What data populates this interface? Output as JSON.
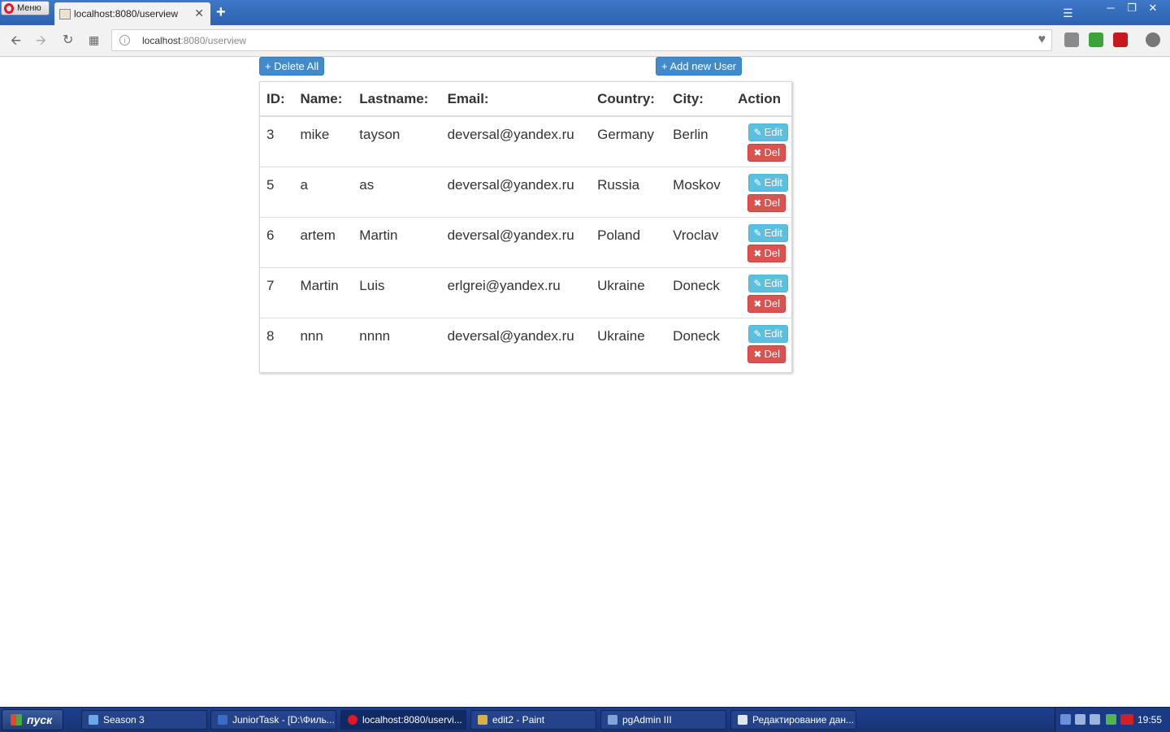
{
  "browser": {
    "menu_label": "Меню",
    "tab_title": "localhost:8080/userview",
    "tab_close": "✕",
    "new_tab": "+",
    "url_host": "localhost",
    "url_rest": ":8080/userview"
  },
  "page": {
    "delete_all_label": "+ Delete All",
    "add_user_label": "+ Add new User",
    "edit_label": "Edit",
    "del_label": "Del",
    "columns": [
      "ID:",
      "Name:",
      "Lastname:",
      "Email:",
      "Country:",
      "City:",
      "Action"
    ],
    "rows": [
      {
        "id": "3",
        "name": "mike",
        "lastname": "tayson",
        "email": "deversal@yandex.ru",
        "country": "Germany",
        "city": "Berlin"
      },
      {
        "id": "5",
        "name": "a",
        "lastname": "as",
        "email": "deversal@yandex.ru",
        "country": "Russia",
        "city": "Moskov"
      },
      {
        "id": "6",
        "name": "artem",
        "lastname": "Martin",
        "email": "deversal@yandex.ru",
        "country": "Poland",
        "city": "Vroclav"
      },
      {
        "id": "7",
        "name": "Martin",
        "lastname": "Luis",
        "email": "erlgrei@yandex.ru",
        "country": "Ukraine",
        "city": "Doneck"
      },
      {
        "id": "8",
        "name": "nnn",
        "lastname": "nnnn",
        "email": "deversal@yandex.ru",
        "country": "Ukraine",
        "city": "Doneck"
      }
    ],
    "colors": {
      "primary": "#428bca",
      "info": "#5bc0de",
      "danger": "#d9534f"
    }
  },
  "taskbar": {
    "start_label": "пуск",
    "tasks": [
      {
        "label": "Season 3",
        "icon": "folder-icon",
        "color": "#6aa8e8"
      },
      {
        "label": "JuniorTask - [D:\\Филь...",
        "icon": "intellij-icon",
        "color": "#3a6cc8"
      },
      {
        "label": "localhost:8080/uservi...",
        "icon": "opera-icon",
        "color": "#e0162b"
      },
      {
        "label": "edit2 - Paint",
        "icon": "paint-icon",
        "color": "#d8b048"
      },
      {
        "label": "pgAdmin III",
        "icon": "pgadmin-icon",
        "color": "#7fa7d6"
      },
      {
        "label": "Редактирование дан...",
        "icon": "notepad-icon",
        "color": "#dfe8f2"
      }
    ],
    "clock": "19:55"
  }
}
